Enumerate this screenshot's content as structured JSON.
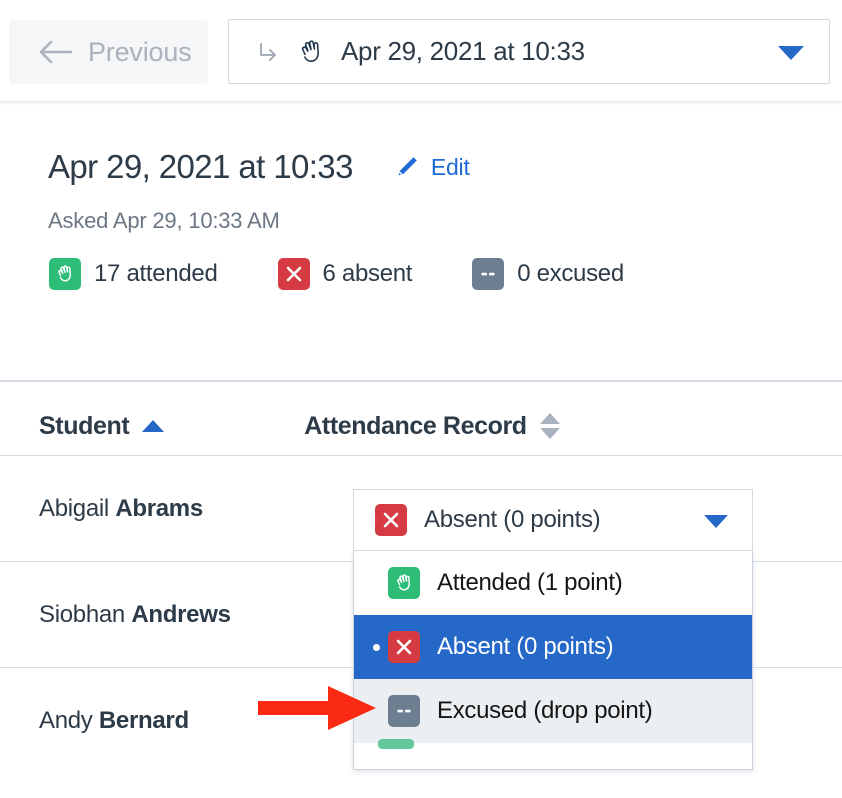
{
  "topbar": {
    "previous_button": "Previous",
    "previous_icon": "arrow-left-icon",
    "session_select": {
      "enter_icon": "enter-arrow-icon",
      "status_icon": "raised-hand-icon",
      "value": "Apr 29, 2021 at 10:33",
      "caret_icon": "chevron-down-icon"
    }
  },
  "detail": {
    "title": "Apr 29, 2021 at 10:33",
    "edit_label": "Edit",
    "edit_icon": "pencil-icon",
    "asked": "Asked Apr 29, 10:33 AM",
    "stats": [
      {
        "icon": "raised-hand-icon",
        "color": "#2ebd77",
        "label": "17 attended",
        "count": 17,
        "status": "attended"
      },
      {
        "icon": "x-icon",
        "color": "#d63b44",
        "label": "6 absent",
        "count": 6,
        "status": "absent"
      },
      {
        "icon": "dash-icon",
        "color": "#6d7e90",
        "label": "0 excused",
        "count": 0,
        "status": "excused"
      }
    ]
  },
  "table": {
    "columns": [
      {
        "label": "Student",
        "sort": "ascending",
        "sort_icon": "sort-ascending-icon"
      },
      {
        "label": "Attendance Record",
        "sort": "none",
        "sort_icon": "sort-both-icon"
      }
    ],
    "rows": [
      {
        "first_name": "Abigail",
        "last_name": "Abrams"
      },
      {
        "first_name": "Siobhan",
        "last_name": "Andrews"
      },
      {
        "first_name": "Andy",
        "last_name": "Bernard"
      }
    ]
  },
  "attendance_select": {
    "selected_label": "Absent (0 points)",
    "selected_icon": "x-icon",
    "caret_icon": "chevron-down-icon",
    "options": [
      {
        "label": "Attended (1 point)",
        "icon": "raised-hand-icon",
        "color": "#2ebd77",
        "state": "normal"
      },
      {
        "label": "Absent (0 points)",
        "icon": "x-icon",
        "color": "#d63b44",
        "state": "selected"
      },
      {
        "label": "Excused (drop point)",
        "icon": "dash-icon",
        "color": "#6d7e90",
        "state": "hovered"
      }
    ]
  },
  "annotation": {
    "arrow": "red-arrow-pointing-right",
    "color": "#fa2a13"
  },
  "colors": {
    "accent_blue": "#2668c8",
    "link_blue": "#1f6bd6",
    "attended_green": "#2ebd77",
    "absent_red": "#d63b44",
    "excused_gray": "#6d7e90",
    "text_dark": "#2d3b48",
    "text_muted": "#6b7785",
    "divider": "#d5dce4"
  }
}
